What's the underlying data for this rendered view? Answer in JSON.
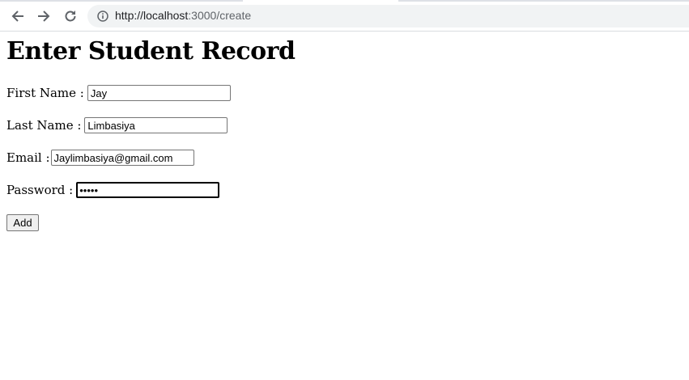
{
  "browser": {
    "url_host": "http://localhost",
    "url_rest": ":3000/create"
  },
  "page": {
    "title": "Enter Student Record"
  },
  "form": {
    "first_name_label": "First Name :",
    "first_name_value": "Jay",
    "last_name_label": "Last Name :",
    "last_name_value": "Limbasiya",
    "email_label": "Email :",
    "email_value": "Jaylimbasiya@gmail.com",
    "password_label": "Password :",
    "password_value": "12345",
    "add_label": "Add"
  }
}
